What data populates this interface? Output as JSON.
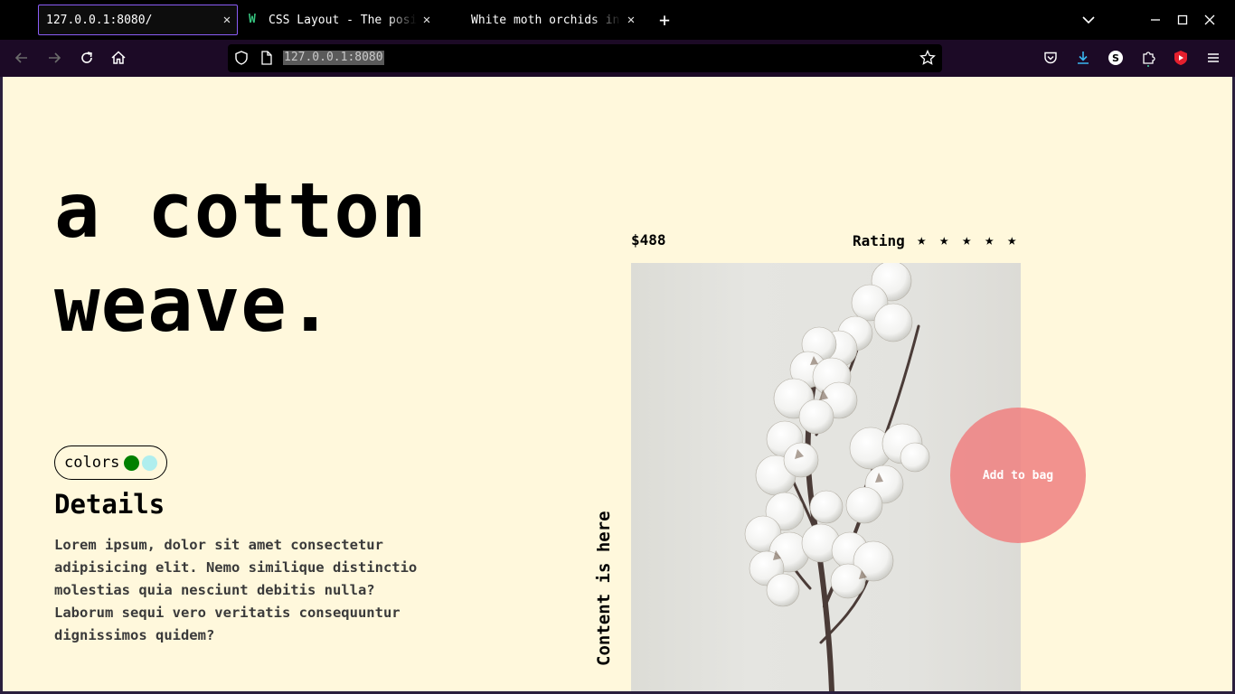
{
  "browser": {
    "tabs": [
      {
        "title": "127.0.0.1:8080/",
        "active": true
      },
      {
        "title": "CSS Layout - The posi",
        "active": false,
        "icon": "w3schools-icon"
      },
      {
        "title": "White moth orchids in",
        "active": false
      }
    ],
    "url": "127.0.0.1:8080",
    "accent_color": "#8a5cf6",
    "chrome_color": "#1c0a26"
  },
  "page": {
    "hero": {
      "line1": "a cotton",
      "line2": "weave."
    },
    "colors": {
      "label": "colors",
      "swatches": [
        "#008000",
        "#afeeee"
      ]
    },
    "details": {
      "title": "Details",
      "text": "Lorem ipsum, dolor sit amet consectetur adipisicing elit. Nemo similique distinctio molestias quia nesciunt debitis nulla? Laborum sequi vero veritatis consequuntur dignissimos quidem?"
    },
    "vertical_label": "Content is here",
    "product": {
      "price": "$488",
      "rating_label": "Rating",
      "stars": 5,
      "star_glyph": "★",
      "add_to_bag": "Add to bag",
      "button_color": "#f08080"
    },
    "background": "#fff8dc"
  }
}
